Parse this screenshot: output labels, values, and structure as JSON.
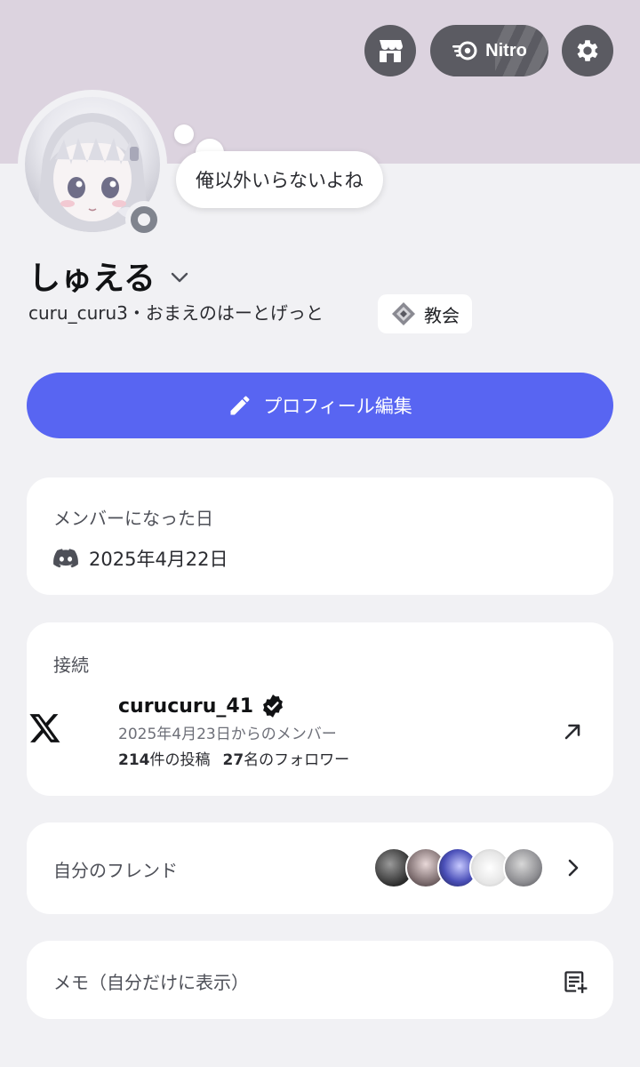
{
  "header": {
    "shop_icon": "shop-icon",
    "nitro_label": "Nitro",
    "settings_icon": "gear-icon"
  },
  "profile": {
    "status_text": "俺以外いらないよね",
    "display_name": "しゅえる",
    "handle_line": "curu_curu3・おまえのはーとげっと",
    "guild_tag": "教会",
    "online_status": "offline"
  },
  "edit_button": {
    "label": "プロフィール編集"
  },
  "member_since": {
    "title": "メンバーになった日",
    "date": "2025年4月22日"
  },
  "connections": {
    "title": "接続",
    "items": [
      {
        "service": "X",
        "username": "curucuru_41",
        "verified": true,
        "since": "2025年4月23日からのメンバー",
        "posts_count": "214",
        "posts_label": "件の投稿",
        "followers_count": "27",
        "followers_label": "名のフォロワー"
      }
    ]
  },
  "friends": {
    "title": "自分のフレンド",
    "avatar_count": 5
  },
  "memo": {
    "title": "メモ（自分だけに表示）"
  },
  "colors": {
    "banner": "#dcd3df",
    "accent": "#5865f2",
    "background": "#f1f1f4",
    "top_button": "#5b5b62"
  }
}
